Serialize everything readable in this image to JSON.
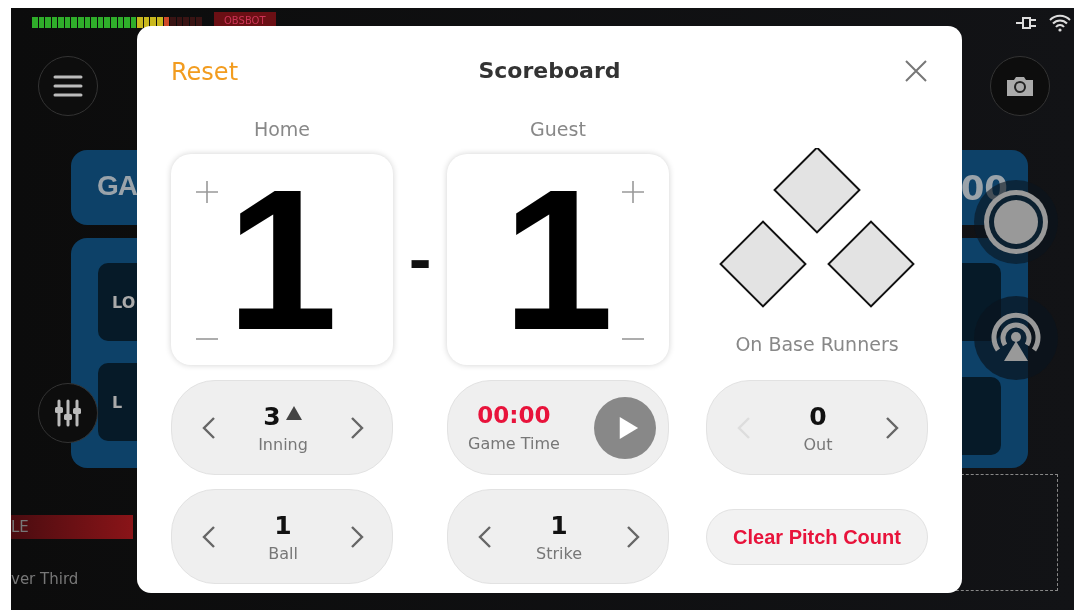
{
  "status_bar": {
    "audio_meter": {
      "level": 0.82
    },
    "brand": "OBSBOT"
  },
  "background": {
    "title_partial": "GA",
    "score_partial": "00",
    "cards": [
      "LO",
      "L"
    ],
    "lower_bar": "LE",
    "lower_third": "ver Third"
  },
  "scoreboard": {
    "reset": "Reset",
    "title": "Scoreboard",
    "teams": [
      {
        "name": "Home",
        "score": "1"
      },
      {
        "name": "Guest",
        "score": "1"
      }
    ],
    "separator": "-",
    "bases": {
      "label": "On Base Runners",
      "runners": [
        {
          "occupied": false
        },
        {
          "occupied": false
        },
        {
          "occupied": false
        }
      ]
    },
    "inning": {
      "value": "3",
      "top_half": true,
      "label": "Inning",
      "prev_disabled": false
    },
    "game_time": {
      "time": "00:00",
      "label": "Game Time",
      "running": false
    },
    "out": {
      "value": "0",
      "label": "Out",
      "prev_disabled": true
    },
    "ball": {
      "value": "1",
      "label": "Ball",
      "prev_disabled": false
    },
    "strike": {
      "value": "1",
      "label": "Strike",
      "prev_disabled": false
    },
    "clear_button": "Clear Pitch Count"
  }
}
